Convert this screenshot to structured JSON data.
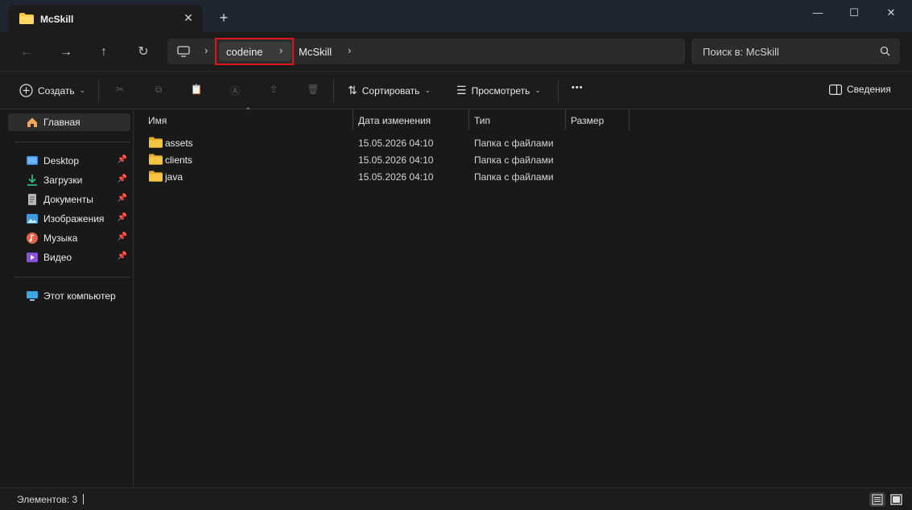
{
  "tab": {
    "title": "McSkill",
    "close_icon": "close-icon",
    "new_tab": "+"
  },
  "window_controls": {
    "minimize": "—",
    "maximize": "☐",
    "close": "✕"
  },
  "address": {
    "breadcrumbs": [
      "codeine",
      "McSkill"
    ],
    "separator": "›"
  },
  "search": {
    "placeholder": "Поиск в: McSkill"
  },
  "toolbar": {
    "create_label": "Создать",
    "sort_label": "Сортировать",
    "view_label": "Просмотреть",
    "more_label": "•••",
    "details_label": "Сведения"
  },
  "sidebar": {
    "home": "Главная",
    "quick": [
      {
        "label": "Desktop",
        "icon": "desktop-icon",
        "color": "#3a8ee6"
      },
      {
        "label": "Загрузки",
        "icon": "downloads-icon",
        "color": "#2fb57a"
      },
      {
        "label": "Документы",
        "icon": "documents-icon",
        "color": "#b8b8b8"
      },
      {
        "label": "Изображения",
        "icon": "pictures-icon",
        "color": "#3a9be0"
      },
      {
        "label": "Музыка",
        "icon": "music-icon",
        "color": "#e0634a"
      },
      {
        "label": "Видео",
        "icon": "videos-icon",
        "color": "#8a4fd8"
      }
    ],
    "this_pc": "Этот компьютер"
  },
  "columns": {
    "name": "Имя",
    "date": "Дата изменения",
    "type": "Тип",
    "size": "Размер"
  },
  "files": [
    {
      "name": "assets",
      "date": "15.05.2026 04:10",
      "type": "Папка с файлами"
    },
    {
      "name": "clients",
      "date": "15.05.2026 04:10",
      "type": "Папка с файлами"
    },
    {
      "name": "java",
      "date": "15.05.2026 04:10",
      "type": "Папка с файлами"
    }
  ],
  "status": {
    "count": "Элементов: 3"
  },
  "colors": {
    "folder": "#f4c542",
    "highlight_box": "#e0141a",
    "accent": "#3a8ee6"
  }
}
